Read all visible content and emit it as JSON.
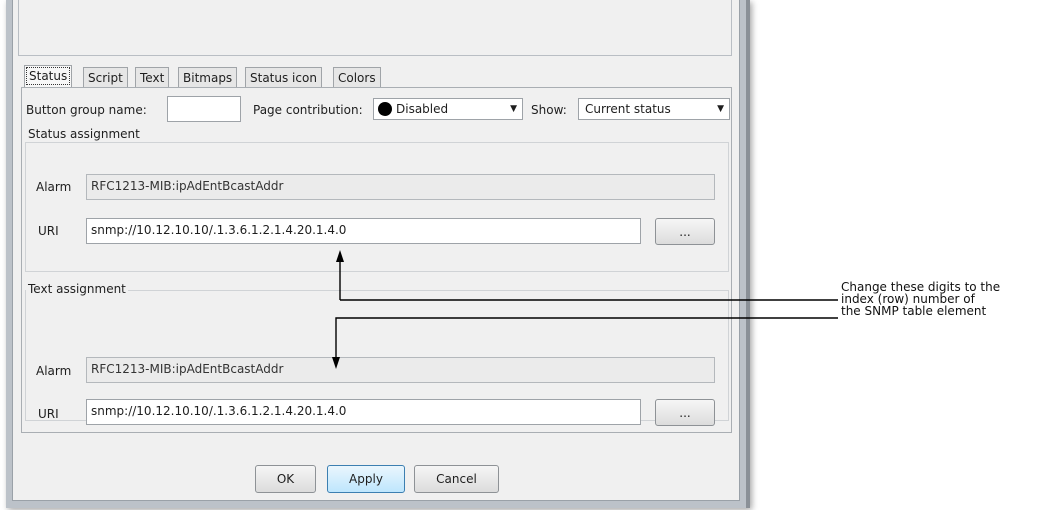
{
  "tabs": [
    {
      "label": "Status"
    },
    {
      "label": "Script"
    },
    {
      "label": "Text"
    },
    {
      "label": "Bitmaps"
    },
    {
      "label": "Status icon"
    },
    {
      "label": "Colors"
    }
  ],
  "toolbar": {
    "button_group_label": "Button group name:",
    "button_group_value": "",
    "page_contribution_label": "Page contribution:",
    "page_contribution_value": "Disabled",
    "page_contribution_color": "#000000",
    "show_label": "Show:",
    "show_value": "Current status"
  },
  "status_assignment": {
    "title": "Status assignment",
    "alarm_label": "Alarm",
    "alarm_value": "RFC1213-MIB:ipAdEntBcastAddr",
    "uri_label": "URI",
    "uri_value": "snmp://10.12.10.10/.1.3.6.1.2.1.4.20.1.4.0",
    "browse_label": "..."
  },
  "text_assignment": {
    "title": "Text assignment",
    "alarm_label": "Alarm",
    "alarm_value": "RFC1213-MIB:ipAdEntBcastAddr",
    "uri_label": "URI",
    "uri_value": "snmp://10.12.10.10/.1.3.6.1.2.1.4.20.1.4.0",
    "browse_label": "..."
  },
  "buttons": {
    "ok": "OK",
    "apply": "Apply",
    "cancel": "Cancel"
  },
  "callout": {
    "line1": "Change these digits to the",
    "line2": "index (row) number of",
    "line3": "the SNMP table element"
  }
}
